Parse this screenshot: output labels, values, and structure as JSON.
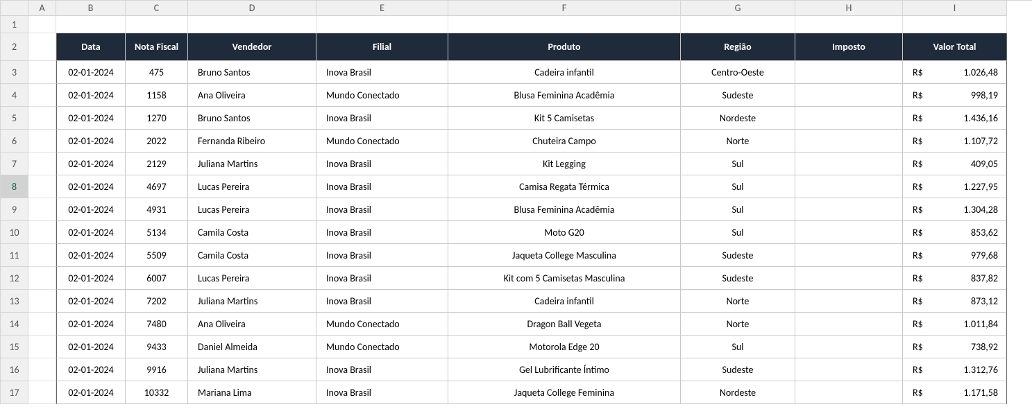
{
  "columns": [
    "A",
    "B",
    "C",
    "D",
    "E",
    "F",
    "G",
    "H",
    "I"
  ],
  "row_numbers": [
    1,
    2,
    3,
    4,
    5,
    6,
    7,
    8,
    9,
    10,
    11,
    12,
    13,
    14,
    15,
    16,
    17
  ],
  "selected_row": 8,
  "headers": {
    "B": "Data",
    "C": "Nota Fiscal",
    "D": "Vendedor",
    "E": "Filial",
    "F": "Produto",
    "G": "Região",
    "H": "Imposto",
    "I": "Valor Total"
  },
  "currency": "R$",
  "rows": [
    {
      "data": "02-01-2024",
      "nota": "475",
      "vend": "Bruno Santos",
      "filial": "Inova Brasil",
      "prod": "Cadeira infantil",
      "reg": "Centro-Oeste",
      "imp": "",
      "valor": "1.026,48"
    },
    {
      "data": "02-01-2024",
      "nota": "1158",
      "vend": "Ana Oliveira",
      "filial": "Mundo Conectado",
      "prod": "Blusa Feminina Acadêmia",
      "reg": "Sudeste",
      "imp": "",
      "valor": "998,19"
    },
    {
      "data": "02-01-2024",
      "nota": "1270",
      "vend": "Bruno Santos",
      "filial": "Inova Brasil",
      "prod": "Kit 5 Camisetas",
      "reg": "Nordeste",
      "imp": "",
      "valor": "1.436,16"
    },
    {
      "data": "02-01-2024",
      "nota": "2022",
      "vend": "Fernanda Ribeiro",
      "filial": "Mundo Conectado",
      "prod": "Chuteira Campo",
      "reg": "Norte",
      "imp": "",
      "valor": "1.107,72"
    },
    {
      "data": "02-01-2024",
      "nota": "2129",
      "vend": "Juliana Martins",
      "filial": "Inova Brasil",
      "prod": "Kit Legging",
      "reg": "Sul",
      "imp": "",
      "valor": "409,05"
    },
    {
      "data": "02-01-2024",
      "nota": "4697",
      "vend": "Lucas Pereira",
      "filial": "Inova Brasil",
      "prod": "Camisa Regata Térmica",
      "reg": "Sul",
      "imp": "",
      "valor": "1.227,95"
    },
    {
      "data": "02-01-2024",
      "nota": "4931",
      "vend": "Lucas Pereira",
      "filial": "Inova Brasil",
      "prod": "Blusa Feminina Acadêmia",
      "reg": "Sul",
      "imp": "",
      "valor": "1.304,28"
    },
    {
      "data": "02-01-2024",
      "nota": "5134",
      "vend": "Camila Costa",
      "filial": "Inova Brasil",
      "prod": "Moto G20",
      "reg": "Sul",
      "imp": "",
      "valor": "853,62"
    },
    {
      "data": "02-01-2024",
      "nota": "5509",
      "vend": "Camila Costa",
      "filial": "Inova Brasil",
      "prod": "Jaqueta College Masculina",
      "reg": "Sudeste",
      "imp": "",
      "valor": "979,68"
    },
    {
      "data": "02-01-2024",
      "nota": "6007",
      "vend": "Lucas Pereira",
      "filial": "Inova Brasil",
      "prod": "Kit com 5 Camisetas Masculina",
      "reg": "Sudeste",
      "imp": "",
      "valor": "837,82"
    },
    {
      "data": "02-01-2024",
      "nota": "7202",
      "vend": "Juliana Martins",
      "filial": "Inova Brasil",
      "prod": "Cadeira infantil",
      "reg": "Norte",
      "imp": "",
      "valor": "873,12"
    },
    {
      "data": "02-01-2024",
      "nota": "7480",
      "vend": "Ana Oliveira",
      "filial": "Mundo Conectado",
      "prod": "Dragon Ball Vegeta",
      "reg": "Norte",
      "imp": "",
      "valor": "1.011,84"
    },
    {
      "data": "02-01-2024",
      "nota": "9433",
      "vend": "Daniel Almeida",
      "filial": "Mundo Conectado",
      "prod": "Motorola Edge 20",
      "reg": "Sul",
      "imp": "",
      "valor": "738,92"
    },
    {
      "data": "02-01-2024",
      "nota": "9916",
      "vend": "Juliana Martins",
      "filial": "Inova Brasil",
      "prod": "Gel Lubrificante Íntimo",
      "reg": "Sudeste",
      "imp": "",
      "valor": "1.312,76"
    },
    {
      "data": "02-01-2024",
      "nota": "10332",
      "vend": "Mariana Lima",
      "filial": "Inova Brasil",
      "prod": "Jaqueta College Feminina",
      "reg": "Nordeste",
      "imp": "",
      "valor": "1.171,58"
    }
  ]
}
